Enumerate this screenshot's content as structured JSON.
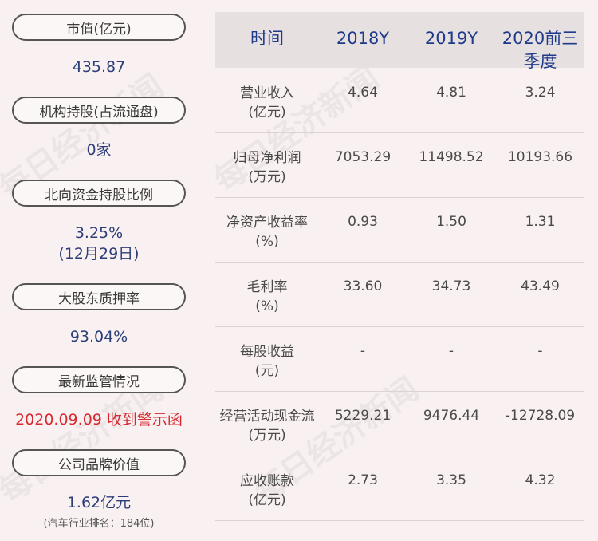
{
  "left_panel": {
    "items": [
      {
        "label": "市值(亿元)",
        "value": "435.87"
      },
      {
        "label": "机构持股(占流通盘)",
        "value": "0家"
      },
      {
        "label": "北向资金持股比例",
        "value_line1": "3.25%",
        "value_line2": "(12月29日)"
      },
      {
        "label": "大股东质押率",
        "value": "93.04%"
      },
      {
        "label": "最新监管情况",
        "value": "2020.09.09 收到警示函"
      },
      {
        "label": "公司品牌价值",
        "value": "1.62亿元",
        "note": "(汽车行业排名：184位)"
      }
    ]
  },
  "table": {
    "headers": [
      "时间",
      "2018Y",
      "2019Y",
      "2020前三",
      "季度"
    ],
    "rows": [
      {
        "label1": "营业收入",
        "label2": "(亿元)",
        "v2018": "4.64",
        "v2019": "4.81",
        "v2020": "3.24"
      },
      {
        "label1": "归母净利润",
        "label2": "(万元)",
        "v2018": "7053.29",
        "v2019": "11498.52",
        "v2020": "10193.66"
      },
      {
        "label1": "净资产收益率",
        "label2": "(%)",
        "v2018": "0.93",
        "v2019": "1.50",
        "v2020": "1.31"
      },
      {
        "label1": "毛利率",
        "label2": "(%)",
        "v2018": "33.60",
        "v2019": "34.73",
        "v2020": "43.49"
      },
      {
        "label1": "每股收益",
        "label2": "(元)",
        "v2018": "-",
        "v2019": "-",
        "v2020": "-"
      },
      {
        "label1": "经营活动现金流",
        "label2": "(万元)",
        "v2018": "5229.21",
        "v2019": "9476.44",
        "v2020": "-12728.09"
      },
      {
        "label1": "应收账款",
        "label2": "(亿元)",
        "v2018": "2.73",
        "v2019": "3.35",
        "v2020": "4.32"
      }
    ]
  },
  "watermark": "每日经济新闻",
  "colors": {
    "accent_blue": "#2c3e78",
    "alert_red": "#d8282f",
    "background": "#f9f1f1"
  }
}
